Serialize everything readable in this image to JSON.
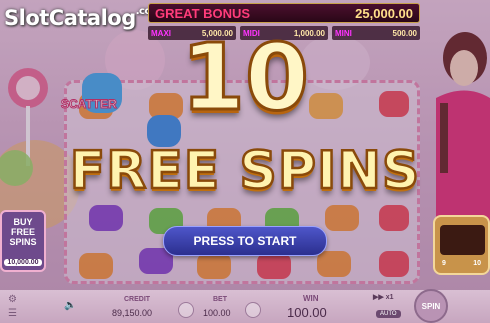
{
  "watermark": {
    "text": "SlotCatalog",
    "suffix": ".com"
  },
  "jackpots": {
    "great": {
      "label": "GREAT BONUS",
      "value": "25,000.00"
    },
    "maxi": {
      "label": "MAXI",
      "value": "5,000.00"
    },
    "midi": {
      "label": "MIDI",
      "value": "1,000.00"
    },
    "mini": {
      "label": "MINI",
      "value": "500.00"
    }
  },
  "overlay": {
    "count": "10",
    "title": "FREE SPINS",
    "start_label": "PRESS TO START"
  },
  "side": {
    "buy_label": [
      "BUY",
      "FREE",
      "SPINS"
    ],
    "buy_price": "10,000.00",
    "scatter_label": "SCATTER",
    "panel_left": "9",
    "panel_right": "10"
  },
  "footer": {
    "credit_label": "CREDIT",
    "credit_value": "89,150.00",
    "bet_label": "BET",
    "bet_value": "100.00",
    "win_label": "WIN",
    "win_value": "100.00",
    "turbo_label": "x1",
    "auto_label": "AUTO",
    "spin_label": "SPIN"
  },
  "colors": {
    "accent": "#ff3c7a",
    "gold": "#ffe08a",
    "button": "#3a40b0"
  }
}
